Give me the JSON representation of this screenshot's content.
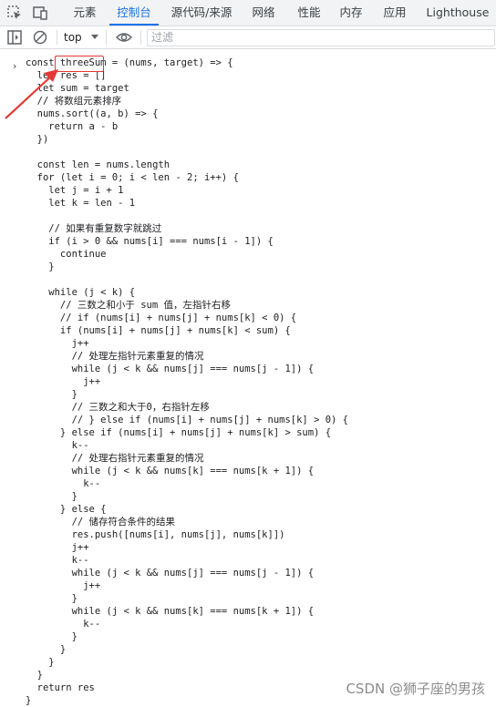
{
  "tabs": [
    "元素",
    "控制台",
    "源代码/来源",
    "网络",
    "性能",
    "内存",
    "应用",
    "Lighthouse"
  ],
  "active_tab": "控制台",
  "toolbar": {
    "context": "top",
    "filter_placeholder": "过滤"
  },
  "code_lines": [
    "const threeSum = (nums, target) => {",
    "  let res = []",
    "  let sum = target",
    "  // 将数组元素排序",
    "  nums.sort((a, b) => {",
    "    return a - b",
    "  })",
    "",
    "  const len = nums.length",
    "  for (let i = 0; i < len - 2; i++) {",
    "    let j = i + 1",
    "    let k = len - 1",
    "",
    "    // 如果有重复数字就跳过",
    "    if (i > 0 && nums[i] === nums[i - 1]) {",
    "      continue",
    "    }",
    "",
    "    while (j < k) {",
    "      // 三数之和小于 sum 值，左指针右移",
    "      // if (nums[i] + nums[j] + nums[k] < 0) {",
    "      if (nums[i] + nums[j] + nums[k] < sum) {",
    "        j++",
    "        // 处理左指针元素重复的情况",
    "        while (j < k && nums[j] === nums[j - 1]) {",
    "          j++",
    "        }",
    "        // 三数之和大于0，右指针左移",
    "        // } else if (nums[i] + nums[j] + nums[k] > 0) {",
    "      } else if (nums[i] + nums[j] + nums[k] > sum) {",
    "        k--",
    "        // 处理右指针元素重复的情况",
    "        while (j < k && nums[k] === nums[k + 1]) {",
    "          k--",
    "        }",
    "      } else {",
    "        // 储存符合条件的结果",
    "        res.push([nums[i], nums[j], nums[k]])",
    "        j++",
    "        k--",
    "        while (j < k && nums[j] === nums[j - 1]) {",
    "          j++",
    "        }",
    "        while (j < k && nums[k] === nums[k + 1]) {",
    "          k--",
    "        }",
    "      }",
    "    }",
    "  }",
    "  return res",
    "}"
  ],
  "watermark": "CSDN @狮子座的男孩",
  "colors": {
    "accent": "#1a73e8",
    "highlight_box": "#e53935",
    "arrow": "#e53935"
  },
  "icons": [
    "inspect-element-icon",
    "device-toggle-icon",
    "sidebar-toggle-icon",
    "clear-console-icon",
    "eye-icon"
  ]
}
